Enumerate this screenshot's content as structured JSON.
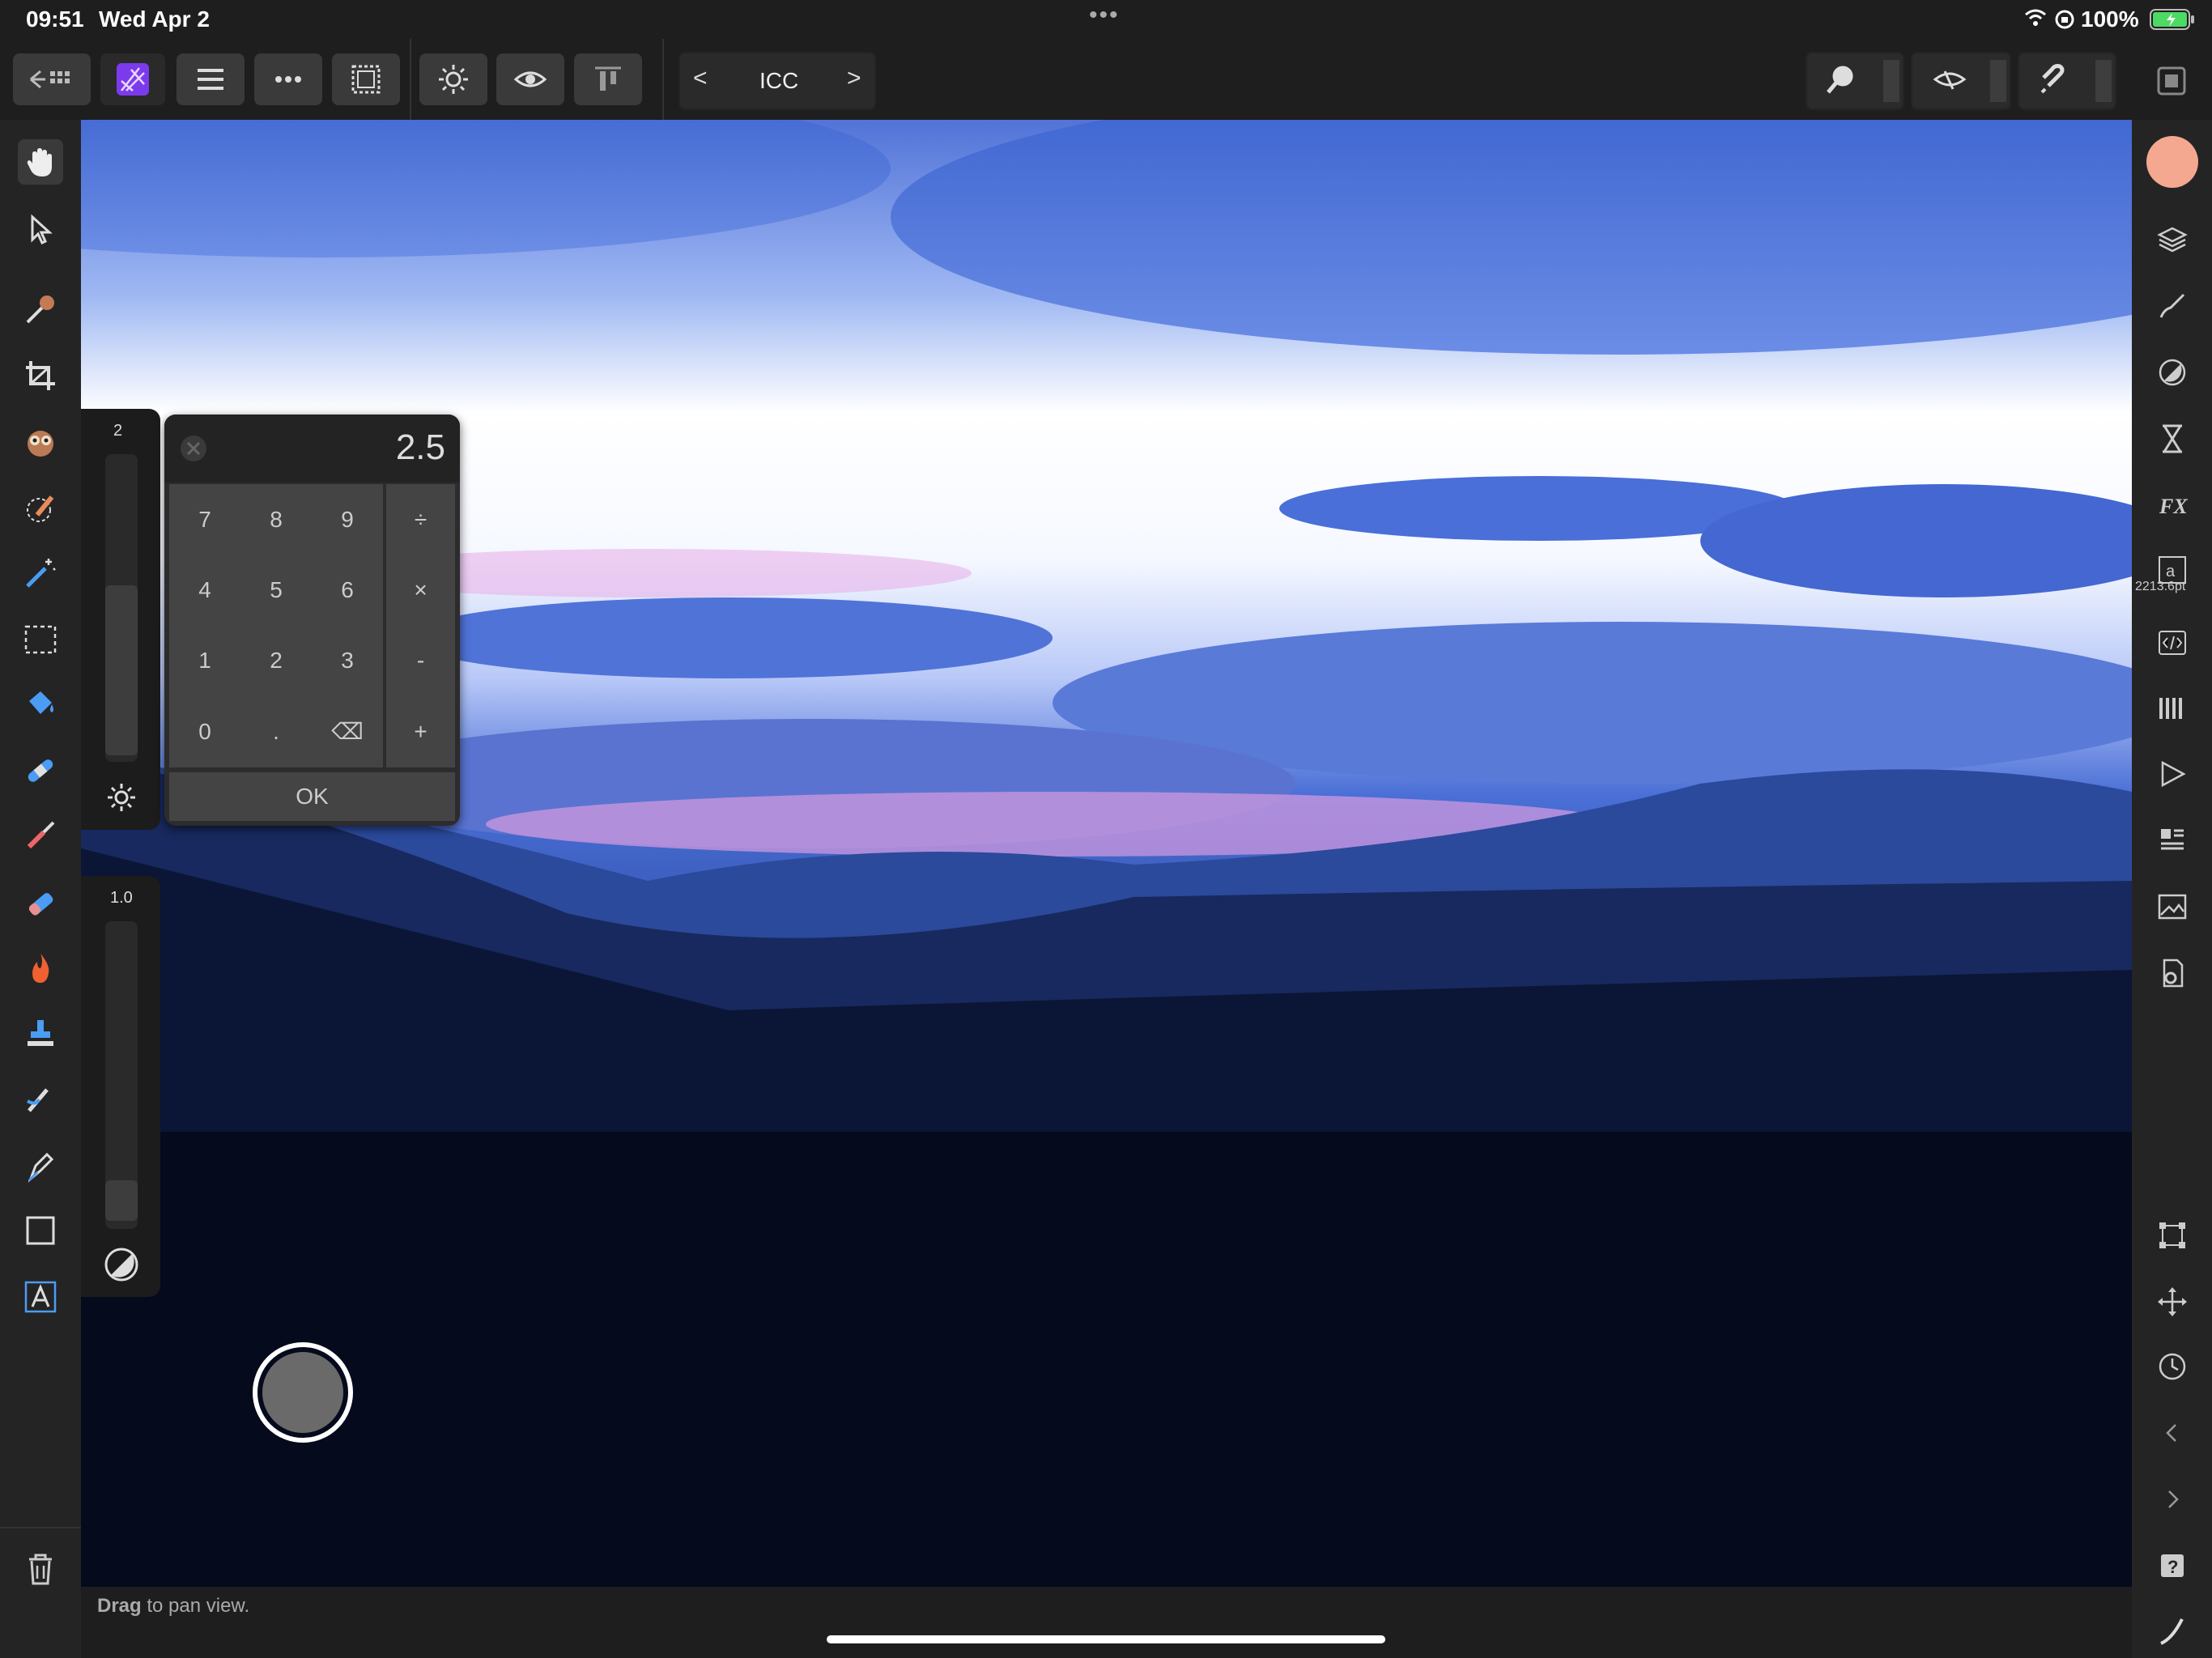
{
  "status": {
    "time": "09:51",
    "date": "Wed Apr 2",
    "more": "•••",
    "battery": "100%"
  },
  "toolbar": {
    "back_icon": "back-grid-icon",
    "app_icon": "affinity-photo-icon",
    "persona_nav": {
      "prev": "<",
      "label": "ICC",
      "next": ">"
    }
  },
  "calculator": {
    "value": "2.5",
    "keys": [
      "7",
      "8",
      "9",
      "÷",
      "4",
      "5",
      "6",
      "×",
      "1",
      "2",
      "3",
      "-",
      "0",
      ".",
      "⌫",
      "+"
    ],
    "ok_label": "OK"
  },
  "sliders": {
    "top_value": "2",
    "bottom_value": "1.0"
  },
  "right_panel": {
    "text_size": "2213.6pt",
    "color_swatch": "#f4a88f"
  },
  "hint": {
    "bold": "Drag",
    "rest": " to pan view."
  },
  "colors": {
    "accent": "#8b3cf6",
    "swatch": "#f4a88f"
  }
}
